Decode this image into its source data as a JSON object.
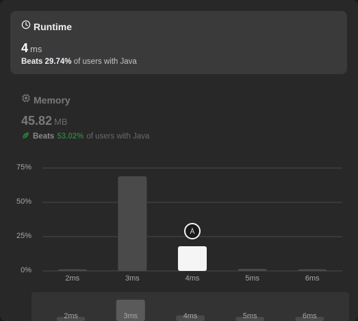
{
  "runtime": {
    "title": "Runtime",
    "value": "4",
    "unit": "ms",
    "beats_prefix": "Beats",
    "beats_pct": "29.74%",
    "beats_suffix": "of users with Java"
  },
  "memory": {
    "title": "Memory",
    "value": "45.82",
    "unit": "MB",
    "beats_prefix": "Beats",
    "beats_pct": "53.02%",
    "beats_suffix": "of users with Java"
  },
  "colors": {
    "bar": "#4a4a4a",
    "bar_selected": "#f5f5f5",
    "grid": "#4a4a4a",
    "accent_green": "#2cbb5d"
  },
  "chart_data": {
    "type": "bar",
    "categories": [
      "2ms",
      "3ms",
      "4ms",
      "5ms",
      "6ms"
    ],
    "values": [
      1.2,
      69,
      18,
      1.5,
      1.2
    ],
    "ylim": [
      0,
      80
    ],
    "yticks": [
      "0%",
      "25%",
      "50%",
      "75%"
    ],
    "ytick_values": [
      0,
      25,
      50,
      75
    ],
    "selected_category": "4ms",
    "marker_icon": "avatar-pin-icon",
    "grid": true,
    "title": "",
    "xlabel": "",
    "ylabel": ""
  },
  "scrubber": {
    "labels": [
      "2ms",
      "3ms",
      "4ms",
      "5ms",
      "6ms"
    ]
  }
}
